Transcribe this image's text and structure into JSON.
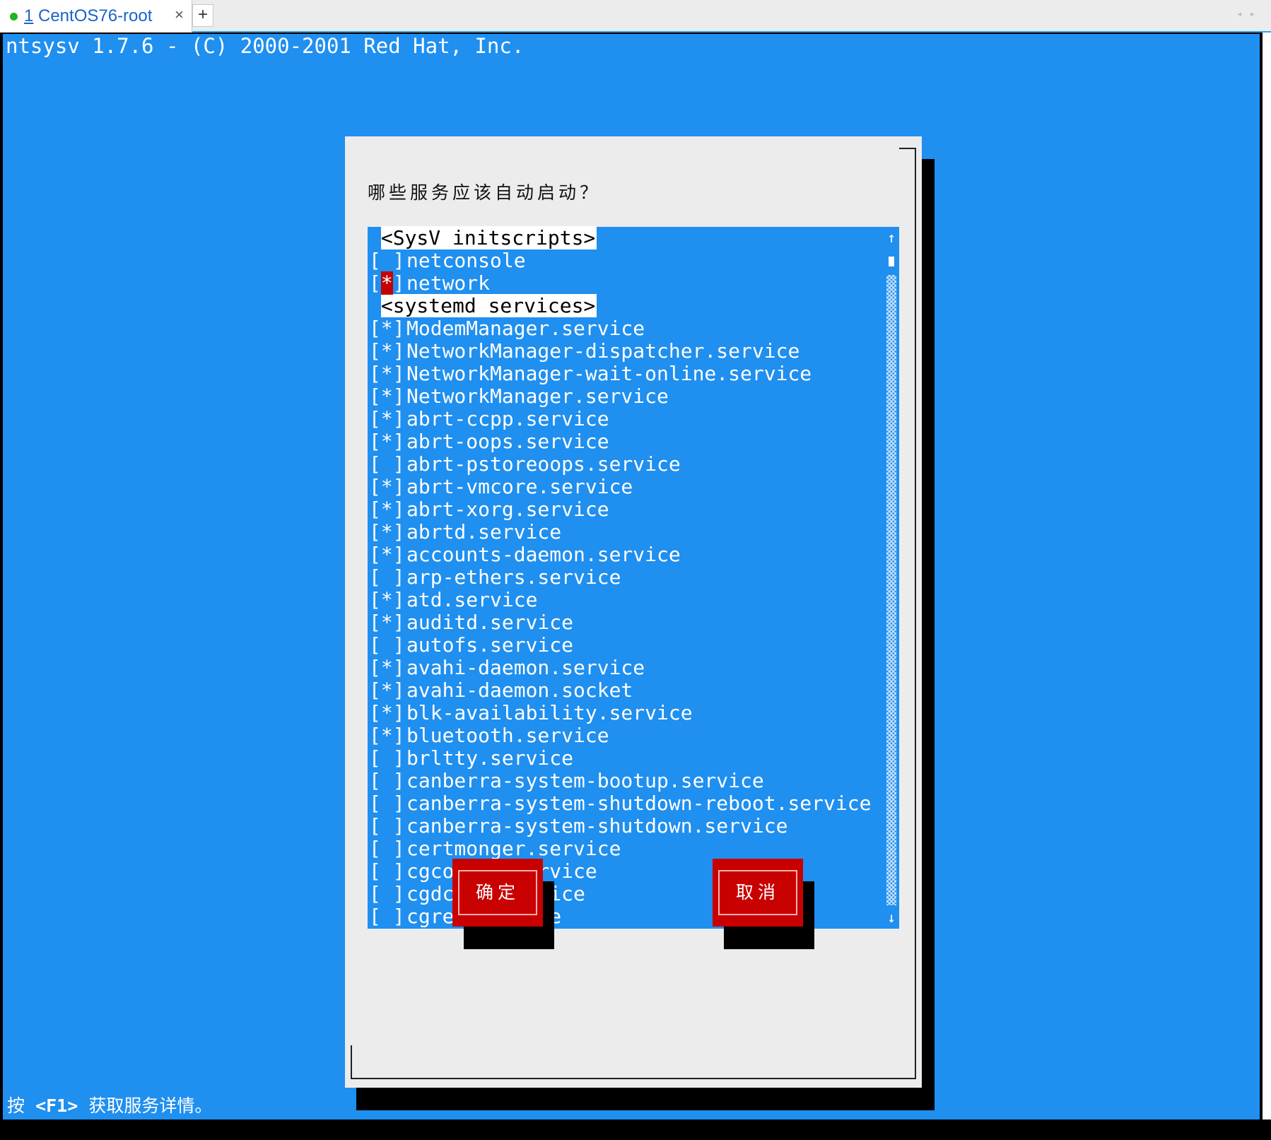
{
  "tabbar": {
    "tab_number": "1",
    "tab_title": "CentOS76-root",
    "close_glyph": "×",
    "new_tab_glyph": "+",
    "status_dot_color": "#21b321"
  },
  "terminal": {
    "title_line": "ntsysv 1.7.6 - (C) 2000-2001 Red Hat, Inc.",
    "hint_prefix": "按 ",
    "hint_key": "<F1>",
    "hint_suffix": " 获取服务详情。",
    "background_color": "#1f8ff0"
  },
  "dialog": {
    "question": "哪些服务应该自动启动？",
    "ok_label": "确定",
    "cancel_label": "取消",
    "button_color": "#c80000",
    "list_items": [
      {
        "type": "header",
        "label": "<SysV initscripts>"
      },
      {
        "type": "item",
        "check": "[ ]",
        "label": "netconsole"
      },
      {
        "type": "item",
        "check": "[*]",
        "label": "network",
        "focused": true
      },
      {
        "type": "header",
        "label": "<systemd services>"
      },
      {
        "type": "item",
        "check": "[*]",
        "label": "ModemManager.service"
      },
      {
        "type": "item",
        "check": "[*]",
        "label": "NetworkManager-dispatcher.service"
      },
      {
        "type": "item",
        "check": "[*]",
        "label": "NetworkManager-wait-online.service"
      },
      {
        "type": "item",
        "check": "[*]",
        "label": "NetworkManager.service"
      },
      {
        "type": "item",
        "check": "[*]",
        "label": "abrt-ccpp.service"
      },
      {
        "type": "item",
        "check": "[*]",
        "label": "abrt-oops.service"
      },
      {
        "type": "item",
        "check": "[ ]",
        "label": "abrt-pstoreoops.service"
      },
      {
        "type": "item",
        "check": "[*]",
        "label": "abrt-vmcore.service"
      },
      {
        "type": "item",
        "check": "[*]",
        "label": "abrt-xorg.service"
      },
      {
        "type": "item",
        "check": "[*]",
        "label": "abrtd.service"
      },
      {
        "type": "item",
        "check": "[*]",
        "label": "accounts-daemon.service"
      },
      {
        "type": "item",
        "check": "[ ]",
        "label": "arp-ethers.service"
      },
      {
        "type": "item",
        "check": "[*]",
        "label": "atd.service"
      },
      {
        "type": "item",
        "check": "[*]",
        "label": "auditd.service"
      },
      {
        "type": "item",
        "check": "[ ]",
        "label": "autofs.service"
      },
      {
        "type": "item",
        "check": "[*]",
        "label": "avahi-daemon.service"
      },
      {
        "type": "item",
        "check": "[*]",
        "label": "avahi-daemon.socket"
      },
      {
        "type": "item",
        "check": "[*]",
        "label": "blk-availability.service"
      },
      {
        "type": "item",
        "check": "[*]",
        "label": "bluetooth.service"
      },
      {
        "type": "item",
        "check": "[ ]",
        "label": "brltty.service"
      },
      {
        "type": "item",
        "check": "[ ]",
        "label": "canberra-system-bootup.service"
      },
      {
        "type": "item",
        "check": "[ ]",
        "label": "canberra-system-shutdown-reboot.service"
      },
      {
        "type": "item",
        "check": "[ ]",
        "label": "canberra-system-shutdown.service"
      },
      {
        "type": "item",
        "check": "[ ]",
        "label": "certmonger.service"
      },
      {
        "type": "item",
        "check": "[ ]",
        "label": "cgconfig.service"
      },
      {
        "type": "item",
        "check": "[ ]",
        "label": "cgdcbxd.service"
      },
      {
        "type": "item",
        "check": "[ ]",
        "label": "cgred.service"
      }
    ],
    "scroll_up_glyph": "↑",
    "scroll_down_glyph": "↓"
  }
}
